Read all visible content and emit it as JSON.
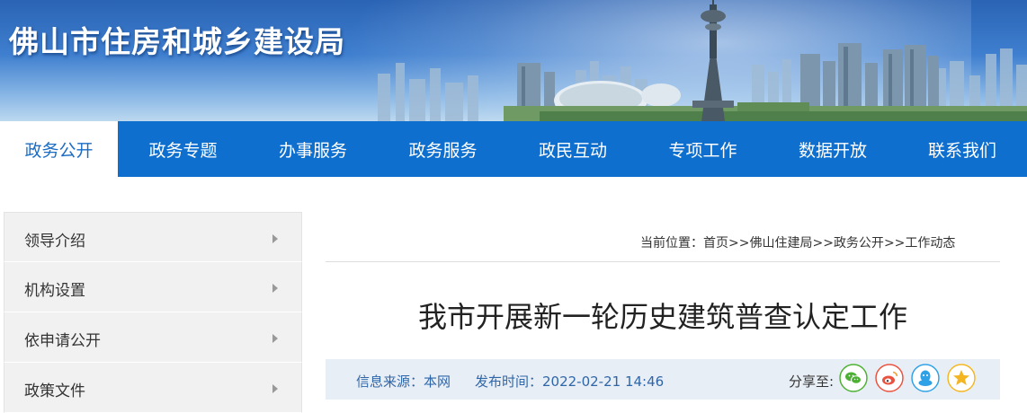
{
  "header": {
    "site_title": "佛山市住房和城乡建设局"
  },
  "nav": {
    "items": [
      {
        "label": "政务公开",
        "active": true
      },
      {
        "label": "政务专题"
      },
      {
        "label": "办事服务"
      },
      {
        "label": "政务服务"
      },
      {
        "label": "政民互动"
      },
      {
        "label": "专项工作"
      },
      {
        "label": "数据开放"
      },
      {
        "label": "联系我们"
      }
    ]
  },
  "sidebar": {
    "items": [
      {
        "label": "领导介绍"
      },
      {
        "label": "机构设置"
      },
      {
        "label": "依申请公开"
      },
      {
        "label": "政策文件"
      }
    ]
  },
  "breadcrumb": {
    "prefix": "当前位置：",
    "items": [
      "首页",
      "佛山住建局",
      "政务公开",
      "工作动态"
    ],
    "separator": ">>"
  },
  "article": {
    "title": "我市开展新一轮历史建筑普查认定工作",
    "source": "信息来源：本网",
    "publish_time": "发布时间：2022-02-21 14:46"
  },
  "share": {
    "label": "分享至:",
    "icons": [
      {
        "name": "wechat-icon",
        "color": "#4cb034"
      },
      {
        "name": "weibo-icon",
        "color": "#e8523e"
      },
      {
        "name": "qq-icon",
        "color": "#2fa1e6"
      },
      {
        "name": "qzone-icon",
        "color": "#f3b521"
      }
    ]
  }
}
